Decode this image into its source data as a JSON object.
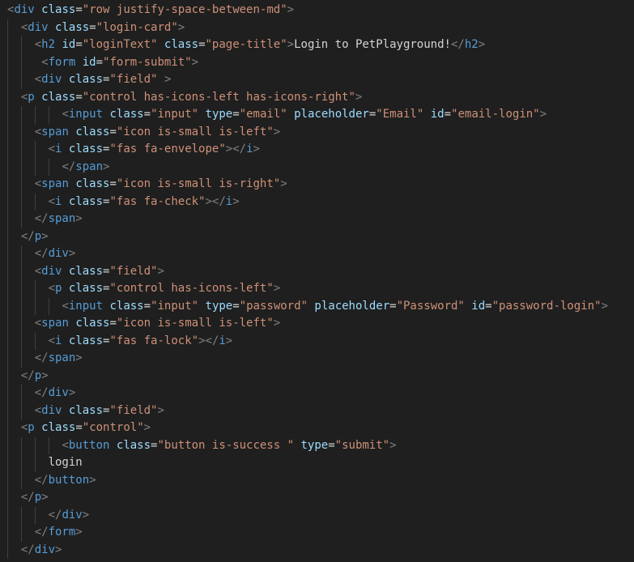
{
  "theme": {
    "background": "#1f1f1f",
    "tag": "#569cd6",
    "punctuation": "#808080",
    "attribute": "#9cdcfe",
    "string": "#ce9178",
    "text": "#d4d4d4",
    "indent_guide": "#404040"
  },
  "lines": [
    {
      "indent": 1,
      "tokens": [
        [
          "p",
          "<"
        ],
        [
          "t",
          "div"
        ],
        [
          "x",
          " "
        ],
        [
          "a",
          "class"
        ],
        [
          "x",
          "="
        ],
        [
          "s",
          "\"row justify-space-between-md\""
        ],
        [
          "p",
          ">"
        ]
      ]
    },
    {
      "indent": 3,
      "tokens": [
        [
          "p",
          "<"
        ],
        [
          "t",
          "div"
        ],
        [
          "x",
          " "
        ],
        [
          "a",
          "class"
        ],
        [
          "x",
          "="
        ],
        [
          "s",
          "\"login-card\""
        ],
        [
          "p",
          ">"
        ]
      ]
    },
    {
      "indent": 5,
      "tokens": [
        [
          "p",
          "<"
        ],
        [
          "t",
          "h2"
        ],
        [
          "x",
          " "
        ],
        [
          "a",
          "id"
        ],
        [
          "x",
          "="
        ],
        [
          "s",
          "\"loginText\""
        ],
        [
          "x",
          " "
        ],
        [
          "a",
          "class"
        ],
        [
          "x",
          "="
        ],
        [
          "s",
          "\"page-title\""
        ],
        [
          "p",
          ">"
        ],
        [
          "x",
          "Login to PetPlayground!"
        ],
        [
          "p",
          "</"
        ],
        [
          "t",
          "h2"
        ],
        [
          "p",
          ">"
        ]
      ]
    },
    {
      "indent": 6,
      "tokens": [
        [
          "p",
          "<"
        ],
        [
          "t",
          "form"
        ],
        [
          "x",
          " "
        ],
        [
          "a",
          "id"
        ],
        [
          "x",
          "="
        ],
        [
          "s",
          "\"form-submit\""
        ],
        [
          "p",
          ">"
        ]
      ]
    },
    {
      "indent": 5,
      "tokens": [
        [
          "p",
          "<"
        ],
        [
          "t",
          "div"
        ],
        [
          "x",
          " "
        ],
        [
          "a",
          "class"
        ],
        [
          "x",
          "="
        ],
        [
          "s",
          "\"field\""
        ],
        [
          "x",
          " "
        ],
        [
          "p",
          ">"
        ]
      ]
    },
    {
      "indent": 3,
      "tokens": [
        [
          "p",
          "<"
        ],
        [
          "t",
          "p"
        ],
        [
          "x",
          " "
        ],
        [
          "a",
          "class"
        ],
        [
          "x",
          "="
        ],
        [
          "s",
          "\"control has-icons-left has-icons-right\""
        ],
        [
          "p",
          ">"
        ]
      ]
    },
    {
      "indent": 9,
      "tokens": [
        [
          "p",
          "<"
        ],
        [
          "t",
          "input"
        ],
        [
          "x",
          " "
        ],
        [
          "a",
          "class"
        ],
        [
          "x",
          "="
        ],
        [
          "s",
          "\"input\""
        ],
        [
          "x",
          " "
        ],
        [
          "a",
          "type"
        ],
        [
          "x",
          "="
        ],
        [
          "s",
          "\"email\""
        ],
        [
          "x",
          " "
        ],
        [
          "a",
          "placeholder"
        ],
        [
          "x",
          "="
        ],
        [
          "s",
          "\"Email\""
        ],
        [
          "x",
          " "
        ],
        [
          "a",
          "id"
        ],
        [
          "x",
          "="
        ],
        [
          "s",
          "\"email-login\""
        ],
        [
          "p",
          ">"
        ]
      ]
    },
    {
      "indent": 5,
      "tokens": [
        [
          "p",
          "<"
        ],
        [
          "t",
          "span"
        ],
        [
          "x",
          " "
        ],
        [
          "a",
          "class"
        ],
        [
          "x",
          "="
        ],
        [
          "s",
          "\"icon is-small is-left\""
        ],
        [
          "p",
          ">"
        ]
      ]
    },
    {
      "indent": 7,
      "tokens": [
        [
          "p",
          "<"
        ],
        [
          "t",
          "i"
        ],
        [
          "x",
          " "
        ],
        [
          "a",
          "class"
        ],
        [
          "x",
          "="
        ],
        [
          "s",
          "\"fas fa-envelope\""
        ],
        [
          "p",
          "></"
        ],
        [
          "t",
          "i"
        ],
        [
          "p",
          ">"
        ]
      ]
    },
    {
      "indent": 9,
      "tokens": [
        [
          "p",
          "</"
        ],
        [
          "t",
          "span"
        ],
        [
          "p",
          ">"
        ]
      ]
    },
    {
      "indent": 5,
      "tokens": [
        [
          "p",
          "<"
        ],
        [
          "t",
          "span"
        ],
        [
          "x",
          " "
        ],
        [
          "a",
          "class"
        ],
        [
          "x",
          "="
        ],
        [
          "s",
          "\"icon is-small is-right\""
        ],
        [
          "p",
          ">"
        ]
      ]
    },
    {
      "indent": 7,
      "tokens": [
        [
          "p",
          "<"
        ],
        [
          "t",
          "i"
        ],
        [
          "x",
          " "
        ],
        [
          "a",
          "class"
        ],
        [
          "x",
          "="
        ],
        [
          "s",
          "\"fas fa-check\""
        ],
        [
          "p",
          "></"
        ],
        [
          "t",
          "i"
        ],
        [
          "p",
          ">"
        ]
      ]
    },
    {
      "indent": 5,
      "tokens": [
        [
          "p",
          "</"
        ],
        [
          "t",
          "span"
        ],
        [
          "p",
          ">"
        ]
      ]
    },
    {
      "indent": 3,
      "tokens": [
        [
          "p",
          "</"
        ],
        [
          "t",
          "p"
        ],
        [
          "p",
          ">"
        ]
      ]
    },
    {
      "indent": 5,
      "tokens": [
        [
          "p",
          "</"
        ],
        [
          "t",
          "div"
        ],
        [
          "p",
          ">"
        ]
      ]
    },
    {
      "indent": 5,
      "tokens": [
        [
          "p",
          "<"
        ],
        [
          "t",
          "div"
        ],
        [
          "x",
          " "
        ],
        [
          "a",
          "class"
        ],
        [
          "x",
          "="
        ],
        [
          "s",
          "\"field\""
        ],
        [
          "p",
          ">"
        ]
      ]
    },
    {
      "indent": 7,
      "tokens": [
        [
          "p",
          "<"
        ],
        [
          "t",
          "p"
        ],
        [
          "x",
          " "
        ],
        [
          "a",
          "class"
        ],
        [
          "x",
          "="
        ],
        [
          "s",
          "\"control has-icons-left\""
        ],
        [
          "p",
          ">"
        ]
      ]
    },
    {
      "indent": 9,
      "tokens": [
        [
          "p",
          "<"
        ],
        [
          "t",
          "input"
        ],
        [
          "x",
          " "
        ],
        [
          "a",
          "class"
        ],
        [
          "x",
          "="
        ],
        [
          "s",
          "\"input\""
        ],
        [
          "x",
          " "
        ],
        [
          "a",
          "type"
        ],
        [
          "x",
          "="
        ],
        [
          "s",
          "\"password\""
        ],
        [
          "x",
          " "
        ],
        [
          "a",
          "placeholder"
        ],
        [
          "x",
          "="
        ],
        [
          "s",
          "\"Password\""
        ],
        [
          "x",
          " "
        ],
        [
          "a",
          "id"
        ],
        [
          "x",
          "="
        ],
        [
          "s",
          "\"password-login\""
        ],
        [
          "p",
          ">"
        ]
      ]
    },
    {
      "indent": 5,
      "tokens": [
        [
          "p",
          "<"
        ],
        [
          "t",
          "span"
        ],
        [
          "x",
          " "
        ],
        [
          "a",
          "class"
        ],
        [
          "x",
          "="
        ],
        [
          "s",
          "\"icon is-small is-left\""
        ],
        [
          "p",
          ">"
        ]
      ]
    },
    {
      "indent": 7,
      "tokens": [
        [
          "p",
          "<"
        ],
        [
          "t",
          "i"
        ],
        [
          "x",
          " "
        ],
        [
          "a",
          "class"
        ],
        [
          "x",
          "="
        ],
        [
          "s",
          "\"fas fa-lock\""
        ],
        [
          "p",
          "></"
        ],
        [
          "t",
          "i"
        ],
        [
          "p",
          ">"
        ]
      ]
    },
    {
      "indent": 5,
      "tokens": [
        [
          "p",
          "</"
        ],
        [
          "t",
          "span"
        ],
        [
          "p",
          ">"
        ]
      ]
    },
    {
      "indent": 3,
      "tokens": [
        [
          "p",
          "</"
        ],
        [
          "t",
          "p"
        ],
        [
          "p",
          ">"
        ]
      ]
    },
    {
      "indent": 5,
      "tokens": [
        [
          "p",
          "</"
        ],
        [
          "t",
          "div"
        ],
        [
          "p",
          ">"
        ]
      ]
    },
    {
      "indent": 5,
      "tokens": [
        [
          "p",
          "<"
        ],
        [
          "t",
          "div"
        ],
        [
          "x",
          " "
        ],
        [
          "a",
          "class"
        ],
        [
          "x",
          "="
        ],
        [
          "s",
          "\"field\""
        ],
        [
          "p",
          ">"
        ]
      ]
    },
    {
      "indent": 3,
      "tokens": [
        [
          "p",
          "<"
        ],
        [
          "t",
          "p"
        ],
        [
          "x",
          " "
        ],
        [
          "a",
          "class"
        ],
        [
          "x",
          "="
        ],
        [
          "s",
          "\"control\""
        ],
        [
          "p",
          ">"
        ]
      ]
    },
    {
      "indent": 9,
      "tokens": [
        [
          "p",
          "<"
        ],
        [
          "t",
          "button"
        ],
        [
          "x",
          " "
        ],
        [
          "a",
          "class"
        ],
        [
          "x",
          "="
        ],
        [
          "s",
          "\"button is-success \""
        ],
        [
          "x",
          " "
        ],
        [
          "a",
          "type"
        ],
        [
          "x",
          "="
        ],
        [
          "s",
          "\"submit\""
        ],
        [
          "p",
          ">"
        ]
      ]
    },
    {
      "indent": 7,
      "tokens": [
        [
          "x",
          "login"
        ]
      ]
    },
    {
      "indent": 5,
      "tokens": [
        [
          "p",
          "</"
        ],
        [
          "t",
          "button"
        ],
        [
          "p",
          ">"
        ]
      ]
    },
    {
      "indent": 3,
      "tokens": [
        [
          "p",
          "</"
        ],
        [
          "t",
          "p"
        ],
        [
          "p",
          ">"
        ]
      ]
    },
    {
      "indent": 7,
      "tokens": [
        [
          "p",
          "</"
        ],
        [
          "t",
          "div"
        ],
        [
          "p",
          ">"
        ]
      ]
    },
    {
      "indent": 5,
      "tokens": [
        [
          "p",
          "</"
        ],
        [
          "t",
          "form"
        ],
        [
          "p",
          ">"
        ]
      ]
    },
    {
      "indent": 3,
      "tokens": [
        [
          "p",
          "</"
        ],
        [
          "t",
          "div"
        ],
        [
          "p",
          ">"
        ]
      ]
    }
  ]
}
